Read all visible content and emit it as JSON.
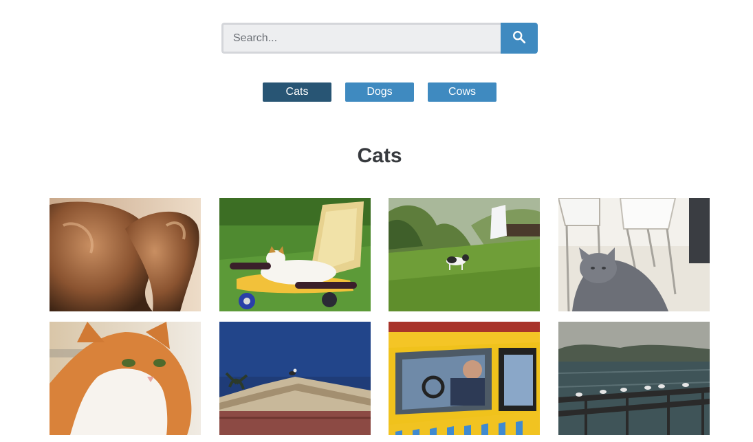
{
  "search": {
    "placeholder": "Search...",
    "value": ""
  },
  "tabs": [
    {
      "label": "Cats",
      "active": true
    },
    {
      "label": "Dogs",
      "active": false
    },
    {
      "label": "Cows",
      "active": false
    }
  ],
  "section": {
    "title": "Cats"
  },
  "colors": {
    "accent": "#3f8ac0",
    "accent_active": "#285574",
    "heading": "#373a3e"
  },
  "gallery": [
    {
      "subject": "bronze cat statues"
    },
    {
      "subject": "cat on scooter seat in grass"
    },
    {
      "subject": "cat walking on lawn"
    },
    {
      "subject": "grey cat under chairs"
    },
    {
      "subject": "orange and white cat portrait"
    },
    {
      "subject": "bird on building roof"
    },
    {
      "subject": "taxi with driver"
    },
    {
      "subject": "seagulls on waterfront railing"
    }
  ]
}
